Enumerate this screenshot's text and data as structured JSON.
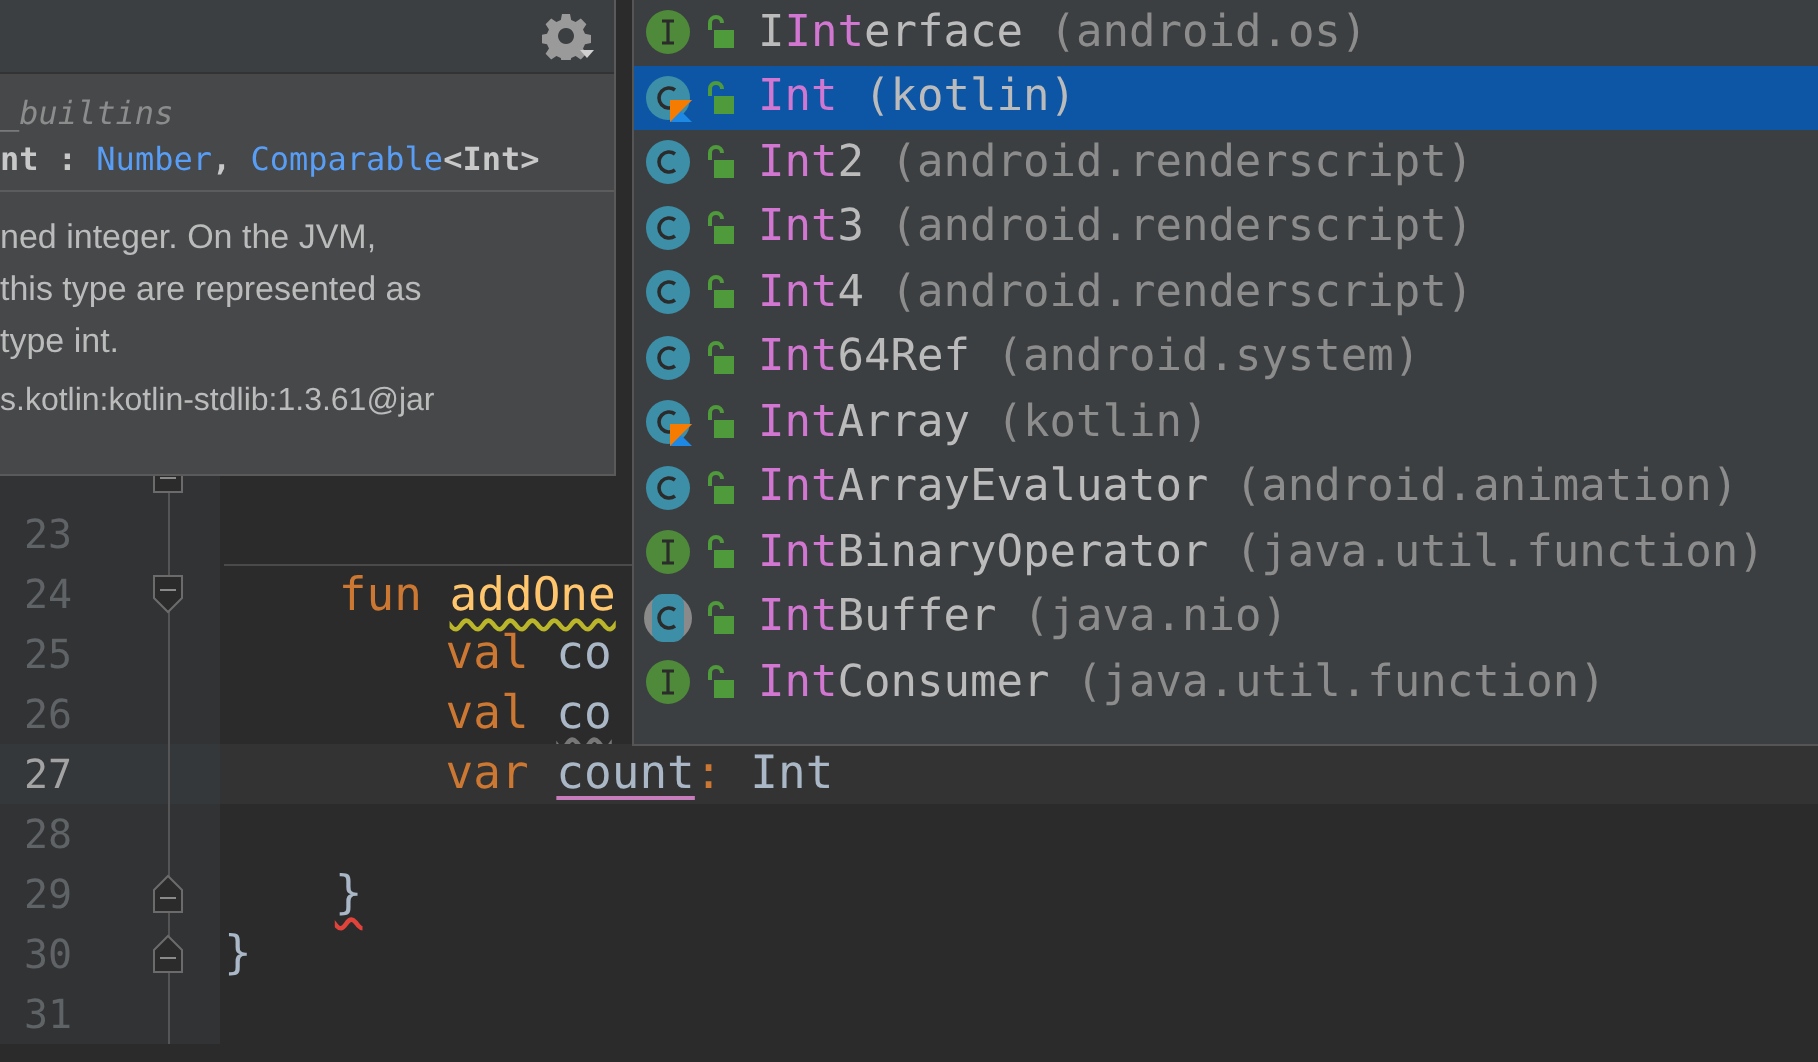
{
  "doc_popup": {
    "module": "_builtins",
    "signature": [
      {
        "kind": "plain",
        "text": "nt : "
      },
      {
        "kind": "link",
        "text": "Number"
      },
      {
        "kind": "plain",
        "text": ", "
      },
      {
        "kind": "link",
        "text": "Comparable"
      },
      {
        "kind": "plain",
        "text": "<Int>"
      }
    ],
    "description_lines": [
      "ned integer. On the JVM,",
      "this type are represented as",
      "type int."
    ],
    "library": "s.kotlin:kotlin-stdlib:1.3.61@jar"
  },
  "completion": [
    {
      "kind": "interface",
      "before": "I",
      "match": "Int",
      "after": "erface",
      "package": "(android.os)",
      "selected": false
    },
    {
      "kind": "kotlin_class",
      "match": "Int",
      "package": "(kotlin)",
      "selected": true
    },
    {
      "kind": "class",
      "match": "Int",
      "after": "2",
      "package": "(android.renderscript)",
      "selected": false
    },
    {
      "kind": "class",
      "match": "Int",
      "after": "3",
      "package": "(android.renderscript)",
      "selected": false
    },
    {
      "kind": "class",
      "match": "Int",
      "after": "4",
      "package": "(android.renderscript)",
      "selected": false
    },
    {
      "kind": "class",
      "match": "Int",
      "after": "64Ref",
      "package": "(android.system)",
      "selected": false
    },
    {
      "kind": "kotlin_class",
      "match": "Int",
      "after": "Array",
      "package": "(kotlin)",
      "selected": false
    },
    {
      "kind": "class",
      "match": "Int",
      "after": "ArrayEvaluator",
      "package": "(android.animation)",
      "selected": false
    },
    {
      "kind": "interface",
      "match": "Int",
      "after": "BinaryOperator",
      "package": "(java.util.function)",
      "selected": false
    },
    {
      "kind": "abstract_class",
      "match": "Int",
      "after": "Buffer",
      "package": "(java.nio)",
      "selected": false
    },
    {
      "kind": "interface",
      "match": "Int",
      "after": "Consumer",
      "package": "(java.util.function)",
      "selected": false
    }
  ],
  "lines": [
    {
      "separator_above": false,
      "fold": {
        "kind": "end"
      }
    },
    {
      "number": "23",
      "current": false,
      "separator_above": false
    },
    {
      "number": "24",
      "current": false,
      "separator_above": true,
      "fold": {
        "kind": "start"
      },
      "tokens": [
        {
          "kind": "keyword",
          "text": "    fun "
        },
        {
          "kind": "function",
          "text": "addOne",
          "underline": {
            "kind": "warning"
          }
        }
      ]
    },
    {
      "number": "25",
      "current": false,
      "separator_above": false,
      "tokens": [
        {
          "kind": "keyword",
          "text": "        val "
        },
        {
          "kind": "plain",
          "text": "co"
        }
      ]
    },
    {
      "number": "26",
      "current": false,
      "separator_above": false,
      "tokens": [
        {
          "kind": "keyword",
          "text": "        val "
        },
        {
          "kind": "plain",
          "text": "co",
          "underline": {
            "kind": "weak"
          }
        }
      ]
    },
    {
      "number": "27",
      "current": true,
      "separator_above": false,
      "tokens": [
        {
          "kind": "keyword",
          "text": "        var "
        },
        {
          "kind": "plain",
          "text": "count",
          "underline": {
            "kind": "usage"
          }
        },
        {
          "kind": "keyword",
          "text": ":"
        },
        {
          "kind": "plain",
          "text": " Int"
        }
      ]
    },
    {
      "number": "28",
      "current": false,
      "separator_above": false
    },
    {
      "number": "29",
      "current": false,
      "separator_above": false,
      "fold": {
        "kind": "end"
      },
      "tokens": [
        {
          "kind": "plain",
          "text": "    }",
          "underline": {
            "kind": "error"
          }
        }
      ]
    },
    {
      "number": "30",
      "current": false,
      "separator_above": false,
      "fold": {
        "kind": "end"
      },
      "tokens": [
        {
          "kind": "plain",
          "text": "}"
        }
      ]
    },
    {
      "number": "31",
      "current": false,
      "separator_above": false
    }
  ]
}
